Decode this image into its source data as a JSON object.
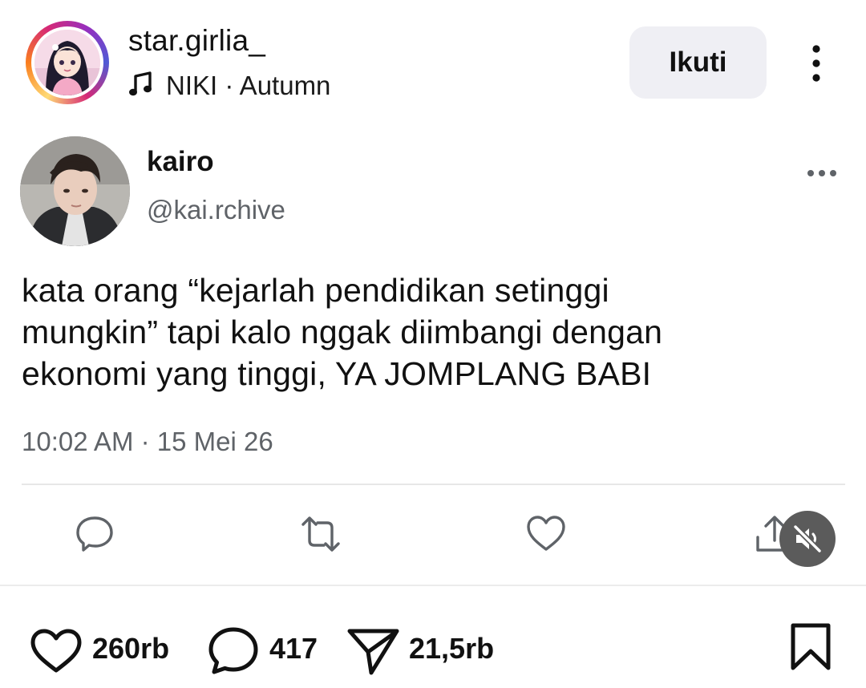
{
  "post_header": {
    "username": "star.girlia_",
    "music": "NIKI · Autumn",
    "follow_label": "Ikuti"
  },
  "tweet": {
    "name": "kairo",
    "handle": "@kai.rchive",
    "text": "kata orang “kejarlah pendidikan setinggi\nmungkin” tapi kalo nggak diimbangi dengan\nekonomi yang tinggi, YA JOMPLANG BABI",
    "meta": "10:02 AM · 15 Mei 26"
  },
  "bottom_bar": {
    "likes": "260rb",
    "comments": "417",
    "shares": "21,5rb"
  },
  "icons": {
    "music": "music-note-icon",
    "more_vertical": "more-vertical-icon",
    "more_horizontal": "more-horizontal-icon",
    "reply": "reply-icon",
    "retweet": "retweet-icon",
    "like": "heart-icon",
    "share": "share-icon",
    "mute": "speaker-muted-icon",
    "comment": "comment-icon",
    "send": "send-icon",
    "save": "bookmark-icon"
  },
  "colors": {
    "follow_bg": "#efeff4",
    "secondary_text": "#5f6368",
    "mute_bg": "#5b5b5b"
  }
}
